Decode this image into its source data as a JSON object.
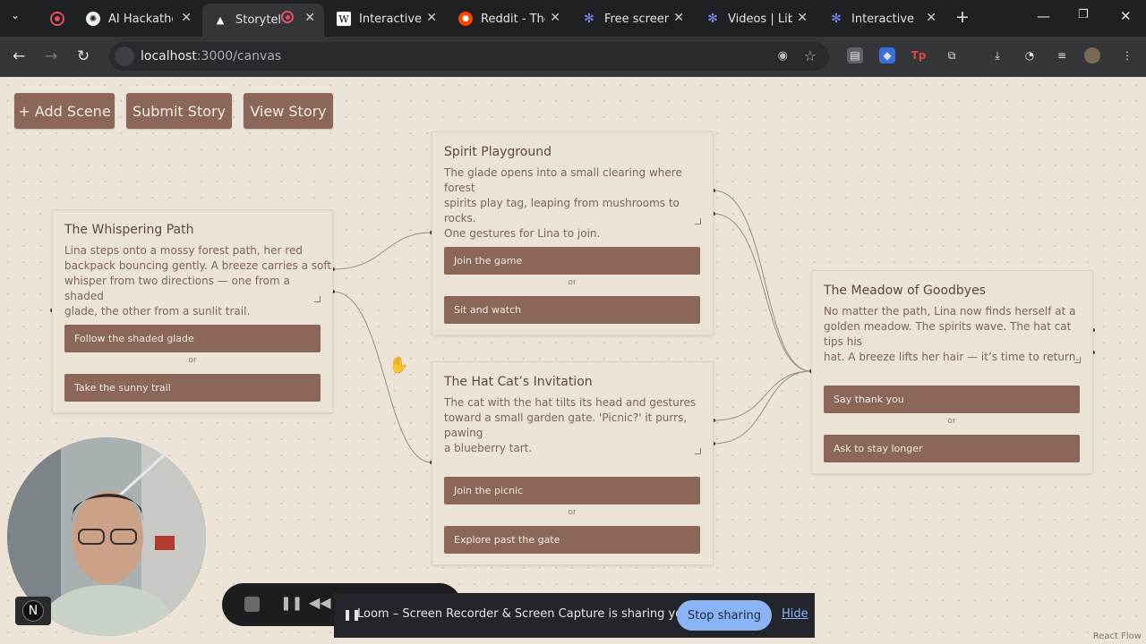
{
  "browser": {
    "tabs": [
      {
        "title": "",
        "icon": "loom-record-icon"
      },
      {
        "title": "AI Hackathon",
        "icon": "openai-icon"
      },
      {
        "title": "Storytelling",
        "icon": "vercel-icon",
        "active": true
      },
      {
        "title": "Interactive st",
        "icon": "wikipedia-icon"
      },
      {
        "title": "Reddit - The",
        "icon": "reddit-icon"
      },
      {
        "title": "Free screen r",
        "icon": "gear-icon"
      },
      {
        "title": "Videos | Libra",
        "icon": "gear-icon"
      },
      {
        "title": "Interactive St",
        "icon": "gear-icon"
      }
    ],
    "new_tab": "+",
    "url_host": "localhost",
    "url_path": ":3000/canvas"
  },
  "toolbar": {
    "add_scene": "+ Add Scene",
    "submit_story": "Submit Story",
    "view_story": "View Story"
  },
  "nodes": [
    {
      "title": "The Whispering Path",
      "lines": [
        "Lina steps onto a mossy forest path, her red",
        "backpack bouncing gently. A breeze carries a soft",
        "whisper from two directions — one from a shaded",
        "glade, the other from a sunlit trail."
      ],
      "choices": [
        "Follow the shaded glade",
        "Take the sunny trail"
      ],
      "or": "or"
    },
    {
      "title": "Spirit Playground",
      "lines": [
        "The glade opens into a small clearing where forest",
        "spirits play tag, leaping from mushrooms to rocks.",
        "One gestures for Lina to join."
      ],
      "choices": [
        "Join the game",
        "Sit and watch"
      ],
      "or": "or"
    },
    {
      "title": "The Hat Cat’s Invitation",
      "lines": [
        "The cat with the hat tilts its head and gestures",
        "toward a small garden gate. 'Picnic?' it purrs, pawing",
        "a blueberry tart."
      ],
      "choices": [
        "Join the picnic",
        "Explore past the gate"
      ],
      "or": "or"
    },
    {
      "title": "The Meadow of Goodbyes",
      "lines": [
        "No matter the path, Lina now finds herself at a",
        "golden meadow. The spirits wave. The hat cat tips his",
        "hat. A breeze lifts her hair — it’s time to return."
      ],
      "choices": [
        "Say thank you",
        "Ask to stay longer"
      ],
      "or": "or"
    }
  ],
  "loom": {
    "message": "Loom – Screen Recorder & Screen Capture is sharing your screen.",
    "stop": "Stop sharing",
    "hide": "Hide"
  },
  "badge": "N",
  "attribution": "React Flow",
  "colors": {
    "accent": "#8c6659",
    "canvas": "#ece4d8",
    "chrome": "#35363a"
  }
}
